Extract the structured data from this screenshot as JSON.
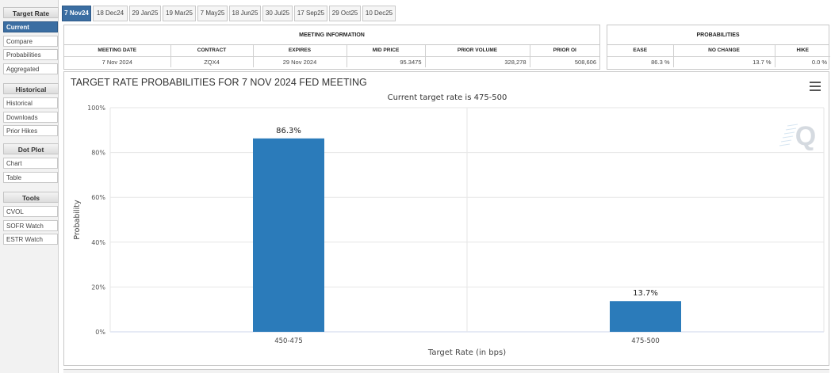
{
  "sidebar": {
    "sections": [
      {
        "heading": "Target Rate",
        "items": [
          "Current",
          "Compare",
          "Probabilities",
          "Aggregated"
        ]
      },
      {
        "heading": "Historical",
        "items": [
          "Historical",
          "Downloads",
          "Prior Hikes"
        ]
      },
      {
        "heading": "Dot Plot",
        "items": [
          "Chart",
          "Table"
        ]
      },
      {
        "heading": "Tools",
        "items": [
          "CVOL",
          "SOFR Watch",
          "ESTR Watch"
        ]
      }
    ],
    "active_item": "Current"
  },
  "tabs": [
    "7 Nov24",
    "18 Dec24",
    "29 Jan25",
    "19 Mar25",
    "7 May25",
    "18 Jun25",
    "30 Jul25",
    "17 Sep25",
    "29 Oct25",
    "10 Dec25"
  ],
  "active_tab": "7 Nov24",
  "meeting_info": {
    "title": "MEETING INFORMATION",
    "headers": [
      "MEETING DATE",
      "CONTRACT",
      "EXPIRES",
      "MID PRICE",
      "PRIOR VOLUME",
      "PRIOR OI"
    ],
    "row": [
      "7 Nov 2024",
      "ZQX4",
      "29 Nov 2024",
      "95.3475",
      "328,278",
      "508,606"
    ]
  },
  "probabilities": {
    "title": "PROBABILITIES",
    "headers": [
      "EASE",
      "NO CHANGE",
      "HIKE"
    ],
    "row": [
      "86.3 %",
      "13.7 %",
      "0.0 %"
    ]
  },
  "chart_data": {
    "type": "bar",
    "title": "TARGET RATE PROBABILITIES FOR 7 NOV 2024 FED MEETING",
    "subtitle": "Current target rate is 475-500",
    "categories": [
      "450-475",
      "475-500"
    ],
    "values": [
      86.3,
      13.7
    ],
    "data_labels": [
      "86.3%",
      "13.7%"
    ],
    "xlabel": "Target Rate (in bps)",
    "ylabel": "Probability",
    "ylim": [
      0,
      100
    ],
    "yticks": [
      "0%",
      "20%",
      "40%",
      "60%",
      "80%",
      "100%"
    ],
    "grid": true,
    "bar_color": "#2b7bba",
    "menu_icon": "hamburger-menu-icon",
    "watermark_icon": "quikstrike-q-logo-icon"
  }
}
